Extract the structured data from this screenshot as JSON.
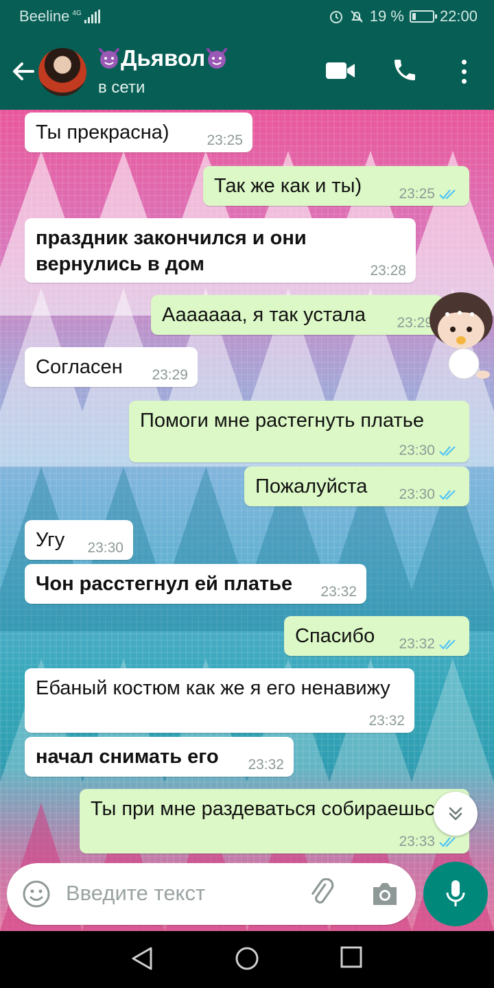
{
  "status_bar": {
    "carrier": "Beeline",
    "network": "4G",
    "battery": "19 %",
    "battery_level": 0.19,
    "time": "22:00"
  },
  "header": {
    "contact_name": "Дьявол",
    "contact_status": "в сети",
    "icons": [
      "back-arrow-icon",
      "avatar",
      "video-call-icon",
      "phone-icon",
      "more-options-icon"
    ]
  },
  "messages": [
    {
      "direction": "in",
      "text": "Ты прекрасна)",
      "time": "23:25",
      "bold": false
    },
    {
      "direction": "out",
      "text": "Так же как и ты)",
      "time": "23:25",
      "bold": false,
      "read": true
    },
    {
      "direction": "in",
      "text": "праздник закончился и они вернулись в дом",
      "time": "23:28",
      "bold": true
    },
    {
      "direction": "out",
      "text": "Ааааааа, я так устала",
      "time": "23:29",
      "bold": false
    },
    {
      "direction": "in",
      "text": "Согласен",
      "time": "23:29",
      "bold": false
    },
    {
      "direction": "out",
      "text": "Помоги мне растегнуть платье",
      "time": "23:30",
      "bold": false,
      "read": true
    },
    {
      "direction": "out",
      "text": "Пожалуйста",
      "time": "23:30",
      "bold": false,
      "read": true
    },
    {
      "direction": "in",
      "text": "Угу",
      "time": "23:30",
      "bold": false
    },
    {
      "direction": "in",
      "text": "Чон расстегнул ей платье",
      "time": "23:32",
      "bold": true
    },
    {
      "direction": "out",
      "text": "Спасибо",
      "time": "23:32",
      "bold": false,
      "read": true
    },
    {
      "direction": "in",
      "text": "Ебаный костюм как же я его ненавижу",
      "time": "23:32",
      "bold": false
    },
    {
      "direction": "in",
      "text": "начал снимать его",
      "time": "23:32",
      "bold": true
    },
    {
      "direction": "out",
      "text": "Ты при мне раздеваться собираешься?",
      "time": "23:33",
      "bold": false,
      "read": true
    }
  ],
  "input": {
    "placeholder": "Введите текст",
    "icons": [
      "emoji-icon",
      "attach-icon",
      "camera-icon",
      "mic-icon"
    ]
  },
  "colors": {
    "header": "#075e54",
    "outgoing_bubble": "#dcf8c6",
    "incoming_bubble": "#ffffff",
    "read_ticks": "#4fc3f7",
    "mic_button": "#00897b"
  }
}
